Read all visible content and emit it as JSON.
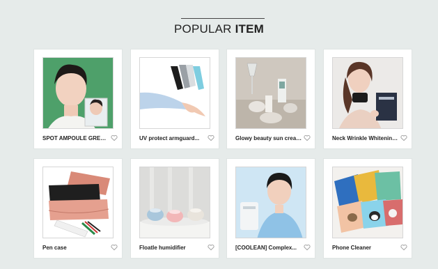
{
  "section": {
    "title_light": "POPULAR ",
    "title_bold": "ITEM"
  },
  "products": [
    {
      "name": "SPOT AMPOULE GREEN...",
      "image": "woman-with-green-background"
    },
    {
      "name": "UV protect armguard...",
      "image": "arm-sleeves"
    },
    {
      "name": "Glowy beauty sun cream.",
      "image": "cream-bottles-and-glassware"
    },
    {
      "name": "Neck Wrinkle Whitening...",
      "image": "woman-with-neck-patch"
    },
    {
      "name": "Pen case",
      "image": "pen-cases"
    },
    {
      "name": "Floatle humidifier",
      "image": "humidifiers"
    },
    {
      "name": "[COOLEAN] Complex...",
      "image": "man-with-device"
    },
    {
      "name": "Phone Cleaner",
      "image": "phone-cleaner-cards"
    }
  ],
  "colors": {
    "background": "#e6ebea",
    "card": "#ffffff",
    "heart": "#9a9a9a"
  }
}
